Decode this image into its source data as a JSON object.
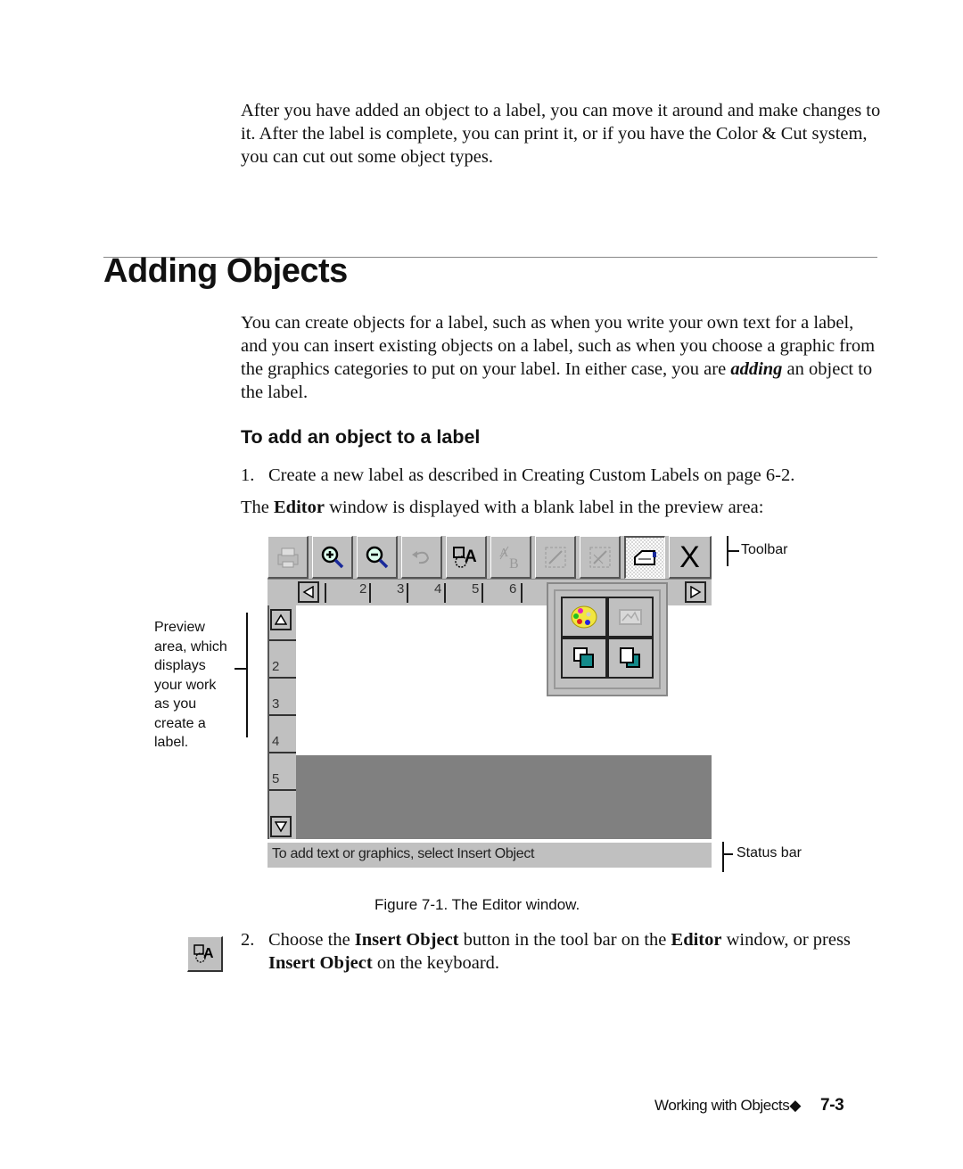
{
  "intro": {
    "text": "After you have added an object to a label, you can move it around and make changes to it. After the label is complete, you can print it, or if you have the Color & Cut system, you can cut out some object types."
  },
  "section": {
    "title": "Adding Objects",
    "para_before": "You can create objects for a label, such as when you write your own text for a label, and you can insert existing objects on a label, such as when you choose a graphic from the graphics categories to put on your label. In either case, you are ",
    "para_emph": "adding",
    "para_after": " an object to the label."
  },
  "procedure": {
    "heading": "To add an object to a label",
    "step1_num": "1.",
    "step1_text": "Create a new label as described in Creating Custom Labels on page 6-2.",
    "editor_note_pre": "The ",
    "editor_note_bold": "Editor",
    "editor_note_post": " window is displayed with a blank label in the preview area:",
    "step2_num": "2.",
    "step2_pre": "Choose the ",
    "step2_bold1": "Insert Object",
    "step2_mid": " button in the tool bar on the ",
    "step2_bold2": "Editor",
    "step2_post": " window, or press",
    "step2_bold3": "Insert Object",
    "step2_end": " on the keyboard."
  },
  "figure": {
    "caption": "Figure 7-1. The Editor window.",
    "toolbar_buttons": [
      {
        "icon": "print-icon",
        "state": "disabled"
      },
      {
        "icon": "zoom-in-icon",
        "state": "enabled"
      },
      {
        "icon": "zoom-out-icon",
        "state": "enabled"
      },
      {
        "icon": "undo-icon",
        "state": "disabled"
      },
      {
        "icon": "insert-object-icon",
        "state": "enabled"
      },
      {
        "icon": "text-size-icon",
        "state": "disabled"
      },
      {
        "icon": "resize-icon",
        "state": "disabled"
      },
      {
        "icon": "resize-alt-icon",
        "state": "disabled"
      },
      {
        "icon": "cut-machine-icon",
        "state": "pressed"
      },
      {
        "icon": "close-icon",
        "state": "enabled",
        "label": "X"
      }
    ],
    "hruler_ticks": [
      "2",
      "3",
      "4",
      "5",
      "6"
    ],
    "vruler_ticks": [
      "2",
      "3",
      "4",
      "5"
    ],
    "popup_buttons": [
      {
        "icon": "palette-icon"
      },
      {
        "icon": "picture-icon"
      },
      {
        "icon": "bring-to-front-icon"
      },
      {
        "icon": "send-to-back-icon"
      }
    ],
    "status_text": "To add text or graphics, select Insert Object",
    "callouts": {
      "toolbar": "Toolbar",
      "status_bar": "Status bar",
      "preview_area": "Preview area, which displays your work as you create a label."
    }
  },
  "footer": {
    "chapter": "Working with Objects",
    "bullet": "◆",
    "page": "7-3"
  }
}
